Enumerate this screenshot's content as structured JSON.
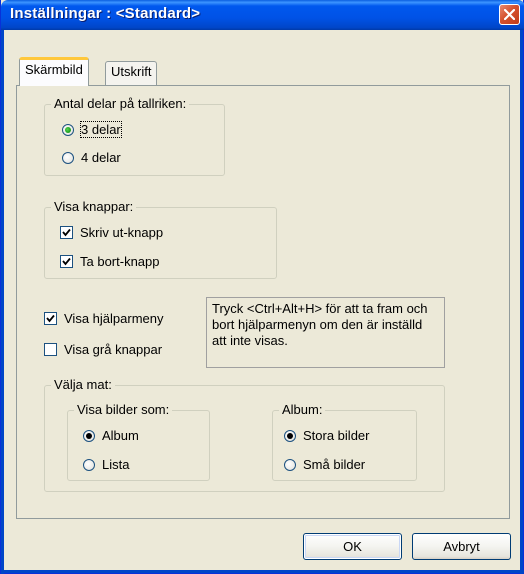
{
  "window": {
    "title": "Inställningar : <Standard>"
  },
  "tabs": [
    {
      "label": "Skärmbild",
      "active": true
    },
    {
      "label": "Utskrift",
      "active": false
    }
  ],
  "group_delar": {
    "legend": "Antal delar på tallriken:",
    "options": [
      {
        "label": "3 delar",
        "selected": true
      },
      {
        "label": "4 delar",
        "selected": false
      }
    ]
  },
  "group_knappar": {
    "legend": "Visa knappar:",
    "options": [
      {
        "label": "Skriv ut-knapp",
        "checked": true
      },
      {
        "label": "Ta bort-knapp",
        "checked": true
      }
    ]
  },
  "visa_hjalpmeny": {
    "label": "Visa hjälparmeny",
    "checked": true
  },
  "visa_gra": {
    "label": "Visa grå knappar",
    "checked": false
  },
  "info_text": "Tryck <Ctrl+Alt+H> för att ta fram och bort hjälparmenyn om den är inställd att inte visas.",
  "group_mat": {
    "legend": "Välja mat:",
    "visa_bilder": {
      "legend": "Visa bilder som:",
      "options": [
        {
          "label": "Album",
          "selected": true
        },
        {
          "label": "Lista",
          "selected": false
        }
      ]
    },
    "album": {
      "legend": "Album:",
      "options": [
        {
          "label": "Stora bilder",
          "selected": true
        },
        {
          "label": "Små bilder",
          "selected": false
        }
      ]
    }
  },
  "buttons": {
    "ok": "OK",
    "cancel": "Avbryt"
  },
  "colors": {
    "titlebar": "#0052e6",
    "close": "#c23b18",
    "dialog_bg": "#ece9d8",
    "tab_highlight": "#ffc83c"
  }
}
